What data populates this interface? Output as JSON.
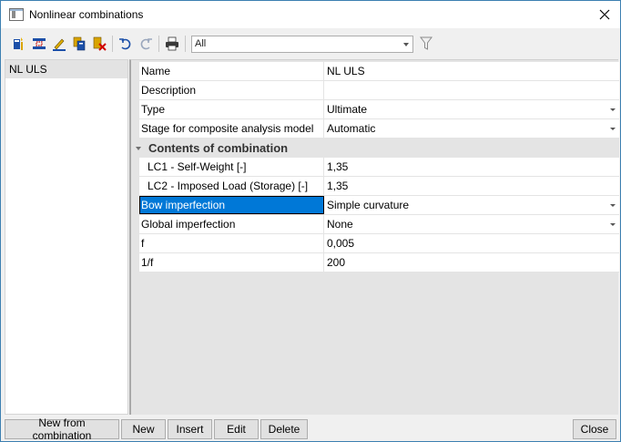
{
  "window": {
    "title": "Nonlinear combinations",
    "close_glyph": "✕"
  },
  "toolbar": {
    "icons": [
      "new-combination-icon",
      "insert-row-icon",
      "edit-icon",
      "copy-icon",
      "delete-icon",
      "undo-icon",
      "redo-icon",
      "print-icon",
      "filter-icon"
    ],
    "filter_value": "All"
  },
  "left_list": {
    "items": [
      "NL ULS"
    ]
  },
  "properties": {
    "name": {
      "label": "Name",
      "value": "NL ULS"
    },
    "description": {
      "label": "Description",
      "value": ""
    },
    "type": {
      "label": "Type",
      "value": "Ultimate"
    },
    "stage": {
      "label": "Stage for composite analysis model",
      "value": "Automatic"
    },
    "section_title": "Contents of combination",
    "lc1": {
      "label": "LC1 - Self-Weight [-]",
      "value": "1,35"
    },
    "lc2": {
      "label": "LC2 - Imposed Load (Storage) [-]",
      "value": "1,35"
    },
    "bow": {
      "label": "Bow imperfection",
      "value": "Simple curvature"
    },
    "global": {
      "label": "Global imperfection",
      "value": "None"
    },
    "f": {
      "label": "f",
      "value": "0,005"
    },
    "inv_f": {
      "label": "1/f",
      "value": "200"
    }
  },
  "buttons": {
    "new_from_combination": "New from combination",
    "new": "New",
    "insert": "Insert",
    "edit": "Edit",
    "delete": "Delete",
    "close": "Close"
  },
  "colors": {
    "selection": "#0078d7",
    "window_border": "#3c7fb1"
  }
}
